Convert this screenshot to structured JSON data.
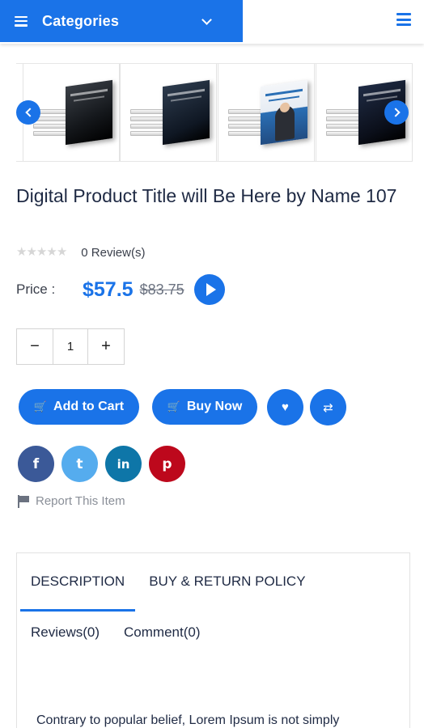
{
  "header": {
    "categories_label": "Categories"
  },
  "carousel": {
    "items": [
      {
        "name": "book-cover-1"
      },
      {
        "name": "book-cover-2"
      },
      {
        "name": "book-cover-3"
      },
      {
        "name": "book-cover-4"
      }
    ]
  },
  "product": {
    "title": "Digital Product Title will Be Here by Name 107",
    "rating_stars": 0,
    "reviews_label": "0 Review(s)",
    "price_label": "Price :",
    "price_current": "$57.5",
    "price_old": "$83.75",
    "quantity": "1",
    "qty_minus": "−",
    "qty_plus": "+"
  },
  "actions": {
    "add_to_cart": "Add to Cart",
    "buy_now": "Buy Now",
    "wishlist_icon": "heart-icon",
    "compare_icon": "swap-icon"
  },
  "social": {
    "facebook": {
      "glyph": "f",
      "color": "#3b5998"
    },
    "twitter": {
      "glyph": "t",
      "color": "#55acee"
    },
    "linkedin": {
      "glyph": "in",
      "color": "#0e76a8"
    },
    "pinterest": {
      "glyph": "p",
      "color": "#bd081c"
    }
  },
  "report_label": "Report This Item",
  "tabs": {
    "description": "DESCRIPTION",
    "policy": "BUY & RETURN POLICY",
    "reviews": "Reviews(0)",
    "comments": "Comment(0)"
  },
  "description_text": "Contrary to popular belief, Lorem Ipsum is not simply",
  "colors": {
    "accent": "#1a73e8"
  }
}
